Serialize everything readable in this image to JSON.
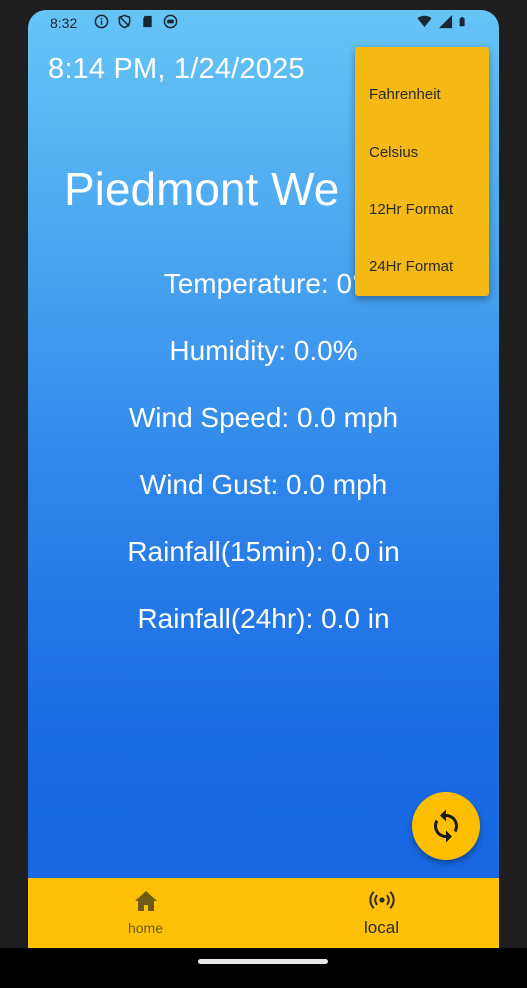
{
  "status_bar": {
    "time": "8:32",
    "left_icons": [
      "info-icon",
      "shield-icon",
      "sd-card-icon",
      "vpn-icon"
    ],
    "right_icons": [
      "wifi-icon",
      "signal-icon",
      "battery-icon"
    ]
  },
  "header": {
    "datetime": "8:14 PM, 1/24/2025",
    "title": "Piedmont We"
  },
  "readings": [
    "Temperature: 0°",
    "Humidity: 0.0%",
    "Wind Speed: 0.0 mph",
    "Wind Gust: 0.0 mph",
    "Rainfall(15min): 0.0 in",
    "Rainfall(24hr): 0.0 in"
  ],
  "menu": {
    "items": [
      "Fahrenheit",
      "Celsius",
      "12Hr Format",
      "24Hr Format"
    ]
  },
  "fab": {
    "icon": "refresh-icon"
  },
  "bottom_nav": {
    "items": [
      {
        "label": "home",
        "icon": "home-icon"
      },
      {
        "label": "local",
        "icon": "broadcast-icon"
      }
    ]
  },
  "colors": {
    "gradient_top": "#66c5f6",
    "gradient_bottom": "#1565e0",
    "menu_bg": "#f4b915",
    "accent": "#ffc107"
  }
}
